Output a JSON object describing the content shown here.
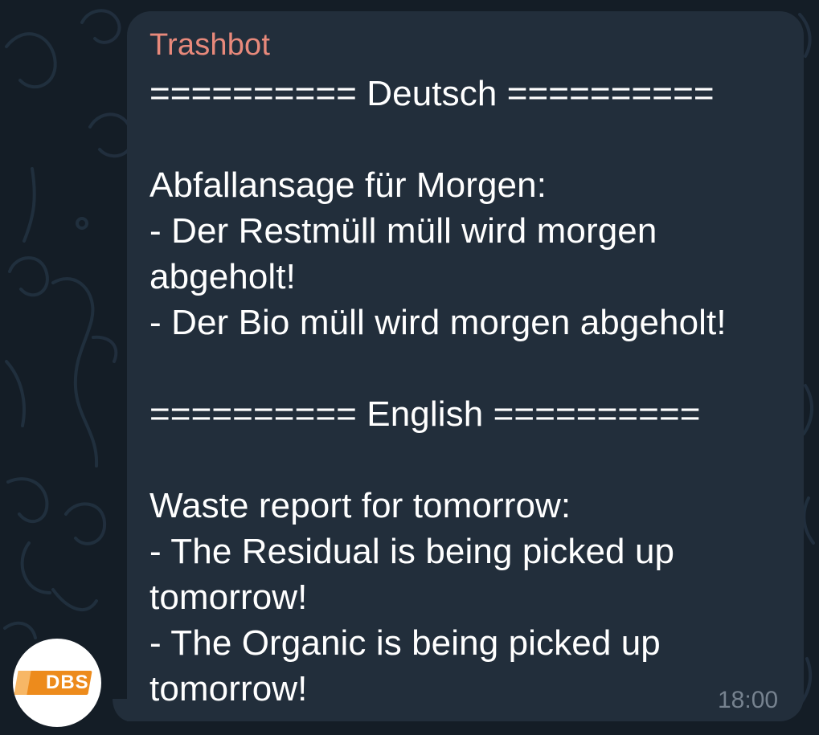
{
  "message": {
    "sender": "Trashbot",
    "time": "18:00",
    "lines": [
      "========== Deutsch ==========",
      "",
      "Abfallansage für Morgen:",
      "- Der Restmüll müll wird morgen",
      "abgeholt!",
      "- Der Bio müll wird morgen abgeholt!",
      "",
      "========== English ==========",
      "",
      "Waste report for tomorrow:",
      "- The Residual is being picked up",
      "tomorrow!",
      "- The Organic is being picked up",
      "tomorrow!"
    ]
  },
  "avatar": {
    "label": "DBS",
    "background_color": "#ffffff",
    "badge_color": "#ed8b1c"
  },
  "theme": {
    "background_color": "#141d26",
    "bubble_color": "#222e3b",
    "sender_color": "#e8897b",
    "text_color": "#ffffff",
    "timestamp_color": "#76828f"
  }
}
